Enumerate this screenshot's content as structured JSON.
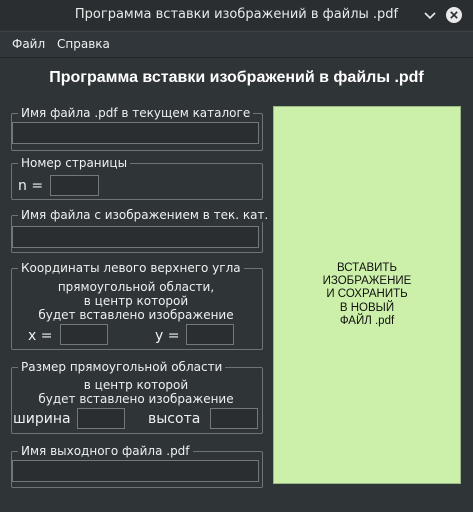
{
  "window": {
    "title": "Программа вставки изображений в файлы .pdf"
  },
  "menubar": {
    "items": [
      "Файл",
      "Справка"
    ]
  },
  "heading": "Программа вставки изображений в файлы .pdf",
  "groups": {
    "pdf_file": {
      "legend": "Имя файла .pdf в текущем каталоге",
      "value": ""
    },
    "page": {
      "legend": "Номер страницы",
      "label": "n =",
      "value": ""
    },
    "image_file": {
      "legend": "Имя файла с изображением в тек. кат.",
      "value": ""
    },
    "coords": {
      "legend": "Координаты левого верхнего угла",
      "line1": "прямоугольной области,",
      "line2": "в центр которой",
      "line3": "будет вставлено изображение",
      "x_label": "x =",
      "y_label": "y =",
      "x_value": "",
      "y_value": ""
    },
    "size": {
      "legend": "Размер прямоугольной области",
      "line1": "в центр которой",
      "line2": "будет вставлено изображение",
      "width_label": "ширина",
      "height_label": "высота",
      "width_value": "",
      "height_value": ""
    },
    "output_file": {
      "legend": "Имя выходного файла .pdf",
      "value": ""
    }
  },
  "insert_button": {
    "label": "ВСТАВИТЬ\nИЗОБРАЖЕНИЕ\nИ СОХРАНИТЬ\nВ НОВЫЙ\nФАЙЛ .pdf",
    "color": "#ccf0aa"
  },
  "icons": {
    "minimize": "chevron-down-icon",
    "close": "close-circle-icon"
  }
}
